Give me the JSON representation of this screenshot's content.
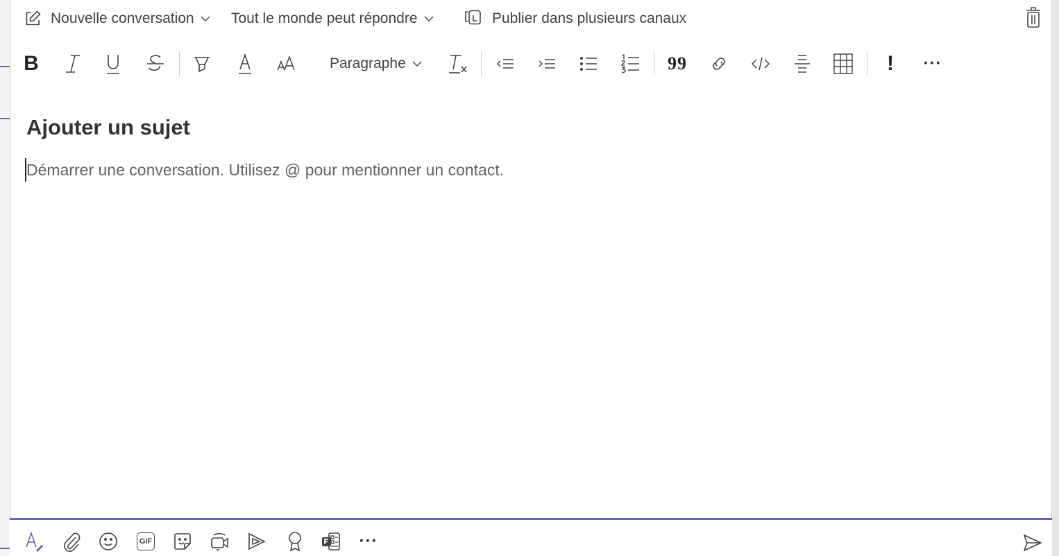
{
  "header": {
    "new_conversation_label": "Nouvelle conversation",
    "reply_setting_label": "Tout le monde peut répondre",
    "multi_channel_label": "Publier dans plusieurs canaux"
  },
  "toolbar": {
    "paragraph_label": "Paragraphe",
    "bold_glyph": "B",
    "quote_glyph": "99",
    "important_glyph": "!",
    "more_glyph": "···",
    "icons": [
      "bold-icon",
      "italic-icon",
      "underline-icon",
      "strikethrough-icon",
      "highlight-icon",
      "font-color-icon",
      "font-size-icon",
      "clear-formatting-icon",
      "decrease-indent-icon",
      "increase-indent-icon",
      "bulleted-list-icon",
      "numbered-list-icon",
      "quote-icon",
      "link-icon",
      "code-snippet-icon",
      "horizontal-rule-icon",
      "table-icon",
      "important-icon",
      "more-options-icon"
    ]
  },
  "compose": {
    "subject_placeholder": "Ajouter un sujet",
    "body_placeholder": "Démarrer une conversation. Utilisez @ pour mentionner un contact."
  },
  "bottom_bar": {
    "gif_label": "GIF",
    "more_glyph": "···",
    "icons": [
      "format-icon",
      "attach-icon",
      "emoji-icon",
      "gif-icon",
      "sticker-icon",
      "meet-now-icon",
      "stream-icon",
      "praise-icon",
      "forms-icon",
      "more-apps-icon",
      "send-icon"
    ]
  },
  "colors": {
    "accent": "#6264a7",
    "icon": "#424242",
    "text": "#242424",
    "placeholder": "#616161"
  }
}
